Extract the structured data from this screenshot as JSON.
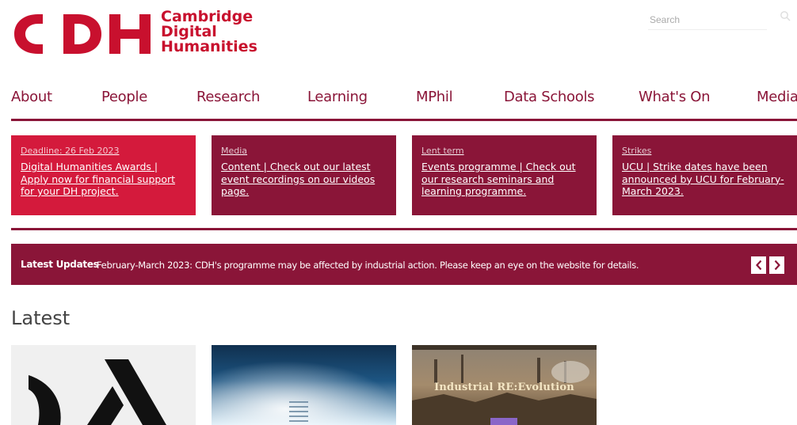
{
  "brand": {
    "logo_lines": [
      "Cambridge",
      "Digital",
      "Humanities"
    ],
    "accent": "#c8102e",
    "maroon": "#8a1538"
  },
  "search": {
    "placeholder": "Search",
    "icon": "search-icon"
  },
  "nav": {
    "items": [
      {
        "label": "About"
      },
      {
        "label": "People"
      },
      {
        "label": "Research"
      },
      {
        "label": "Learning"
      },
      {
        "label": "MPhil"
      },
      {
        "label": "Data Schools"
      },
      {
        "label": "What's On"
      },
      {
        "label": "Media"
      }
    ]
  },
  "cards": [
    {
      "kicker": "Deadline: 26 Feb 2023",
      "body": "Digital Humanities Awards | Apply now for financial support for your DH project.",
      "color": "#d41a3c"
    },
    {
      "kicker": "Media",
      "body": "Content | Check out our latest event recordings on our videos page.",
      "color": "#8a1538"
    },
    {
      "kicker": "Lent term",
      "body": "Events programme | Check out our research seminars and learning programme.",
      "color": "#8a1538"
    },
    {
      "kicker": "Strikes",
      "body": "UCU | Strike dates have been announced by UCU for February-March 2023.",
      "color": "#8a1538"
    }
  ],
  "updates": {
    "label": "Latest Updates",
    "text": "February-March 2023: CDH's programme may be affected by industrial action. Please keep an eye on the website for details.",
    "prev_icon": "chevron-left-icon",
    "next_icon": "chevron-right-icon"
  },
  "latest": {
    "title": "Latest",
    "items": [
      {
        "image": "dh-logo-graphic"
      },
      {
        "image": "blue-abstract-photo"
      },
      {
        "image": "industrial-painting",
        "overlay_title": "Industrial RE:Evolution"
      }
    ]
  }
}
